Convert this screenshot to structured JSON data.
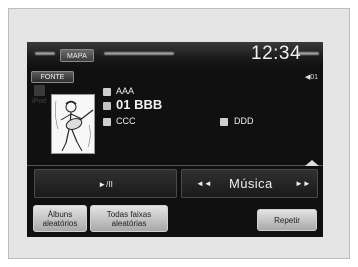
{
  "topbar": {
    "map_label": "MAPA",
    "clock": "12:34"
  },
  "source": {
    "fonte_label": "FONTE",
    "volume": "◀01",
    "ipod_label": "iPod"
  },
  "track": {
    "artist": "AAA",
    "title": "01 BBB",
    "album": "CCC",
    "genre": "DDD"
  },
  "controls": {
    "play_pause": "►/II",
    "prev": "◄◄",
    "music_label": "Música",
    "next": "►►"
  },
  "options": {
    "shuffle_albums": [
      "Álbuns",
      "aleatórios"
    ],
    "shuffle_all": [
      "Todas faixas",
      "aleatórias"
    ],
    "repeat": "Repetir"
  },
  "colors": {
    "screen_bg": "#101010",
    "bezel": "#e4e4e4",
    "button_gray": "#c8c8c8"
  }
}
